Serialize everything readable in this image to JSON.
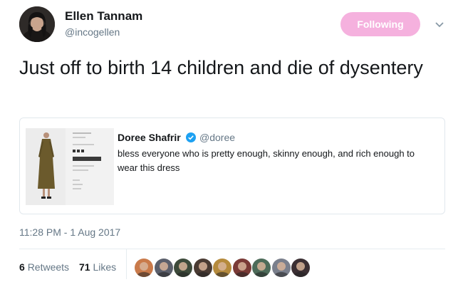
{
  "author": {
    "name": "Ellen Tannam",
    "handle": "@incogellen"
  },
  "follow_button": {
    "label": "Following",
    "color": "#f5b1de"
  },
  "tweet": {
    "text": "Just off to birth 14 children and die of dysentery",
    "timestamp": "11:28 PM - 1 Aug 2017"
  },
  "quote": {
    "name": "Doree Shafrir",
    "handle": "@doree",
    "verified": true,
    "text": "bless everyone who is pretty enough, skinny enough, and rich enough to wear this dress",
    "media_icon": "dress-thumbnail"
  },
  "stats": {
    "retweets_count": "6",
    "retweets_label": "Retweets",
    "likes_count": "71",
    "likes_label": "Likes"
  },
  "liker_avatars": [
    {
      "color": "#c97a4a"
    },
    {
      "color": "#5b5f6b"
    },
    {
      "color": "#3d4a3a"
    },
    {
      "color": "#4a3b33"
    },
    {
      "color": "#b58a3c"
    },
    {
      "color": "#7a3a36"
    },
    {
      "color": "#4d6b59"
    },
    {
      "color": "#7a7f8c"
    },
    {
      "color": "#3b2f33"
    }
  ],
  "colors": {
    "text": "#14171a",
    "secondary": "#657786",
    "verified": "#1da1f2",
    "border": "#e1e8ed"
  }
}
